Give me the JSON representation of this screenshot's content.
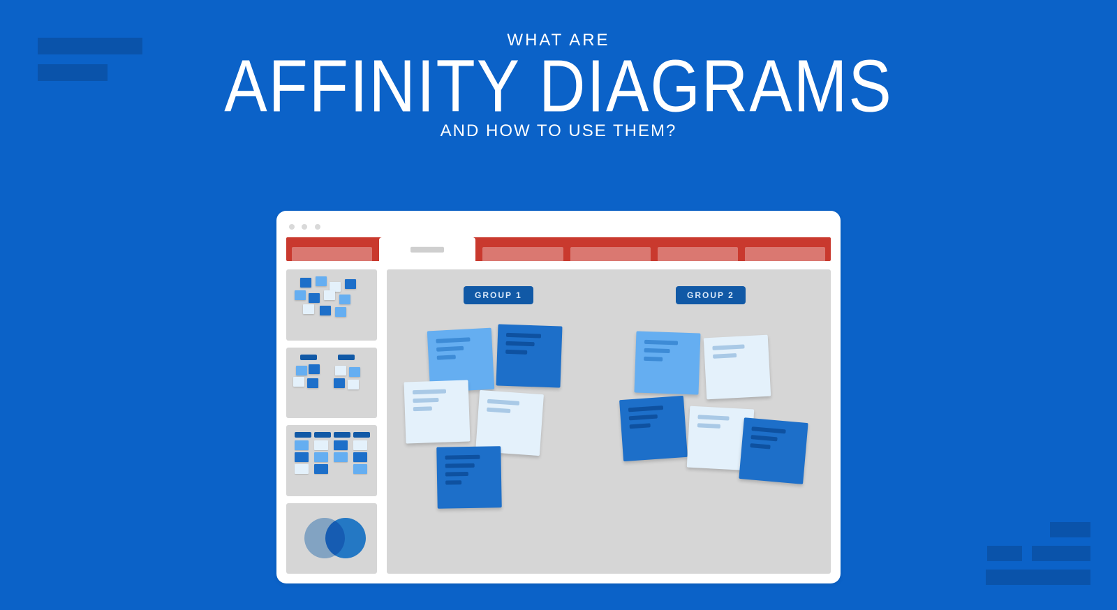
{
  "title": {
    "line1": "WHAT ARE",
    "line2": "AFFINITY DIAGRAMS",
    "line3": "AND HOW TO USE THEM?"
  },
  "groups": {
    "g1": "GROUP 1",
    "g2": "GROUP 2"
  },
  "colors": {
    "bg": "#0b62c8",
    "bg_dark": "#0a53aa",
    "ribbon": "#c9392e",
    "panel": "#d6d6d6",
    "chip": "#1159a6",
    "note_light": "#e4f1fb",
    "note_mid": "#65aef1",
    "note_dark": "#1d6fc9"
  }
}
